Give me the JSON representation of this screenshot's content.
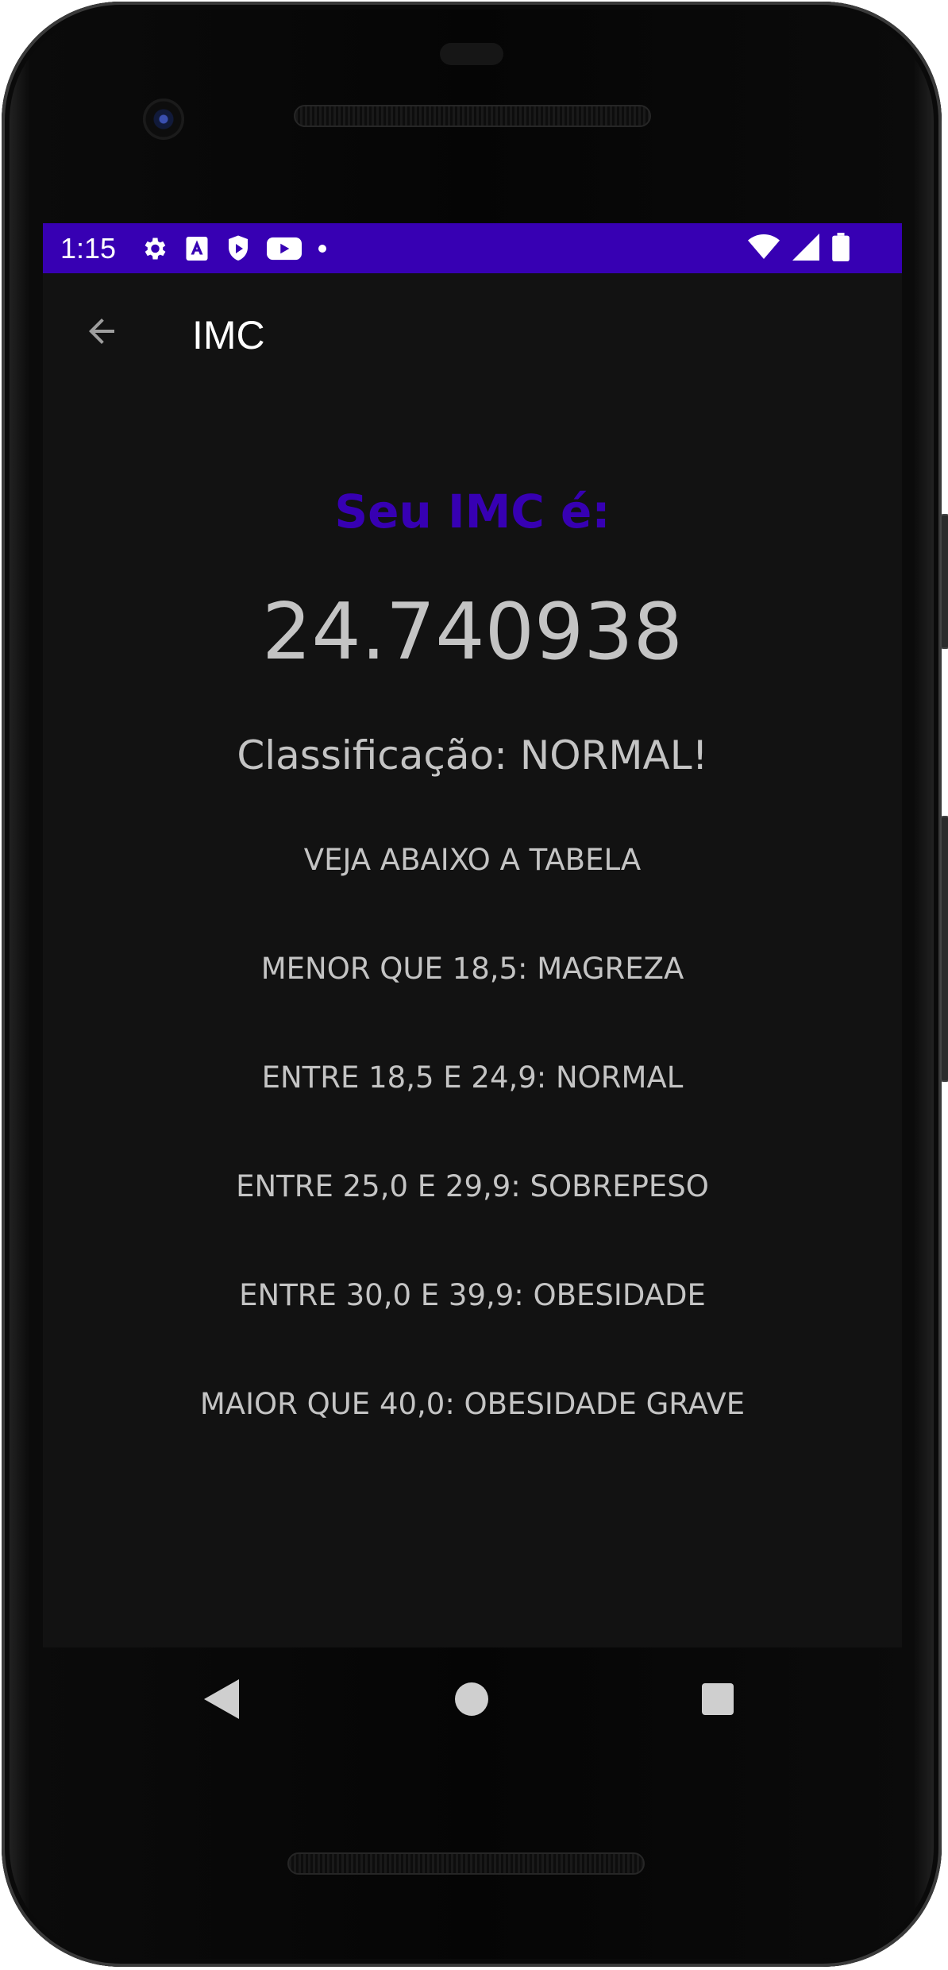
{
  "status_bar": {
    "time": "1:15",
    "background_color": "#3700b3",
    "left_icons": [
      "settings-icon",
      "a-notification-icon",
      "shield-play-icon",
      "youtube-icon",
      "dot-icon"
    ],
    "right_icons": [
      "wifi-icon",
      "signal-icon",
      "battery-icon"
    ]
  },
  "app_bar": {
    "title": "IMC",
    "back_icon": "arrow-back-icon"
  },
  "result": {
    "heading": "Seu IMC é:",
    "heading_color": "#3700b3",
    "value": "24.740938",
    "classification": "Classificação: NORMAL!"
  },
  "table": {
    "intro": "VEJA ABAIXO A TABELA",
    "rows": [
      "MENOR QUE 18,5: MAGREZA",
      "ENTRE 18,5 E 24,9: NORMAL",
      "ENTRE 25,0 E 29,9: SOBREPESO",
      "ENTRE 30,0 E 39,9: OBESIDADE",
      "MAIOR QUE 40,0: OBESIDADE GRAVE"
    ]
  },
  "nav_bar": {
    "buttons": [
      "back-triangle-icon",
      "home-circle-icon",
      "recents-square-icon"
    ]
  }
}
